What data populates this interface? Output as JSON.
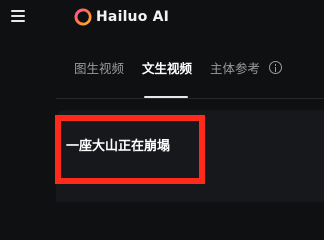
{
  "app": {
    "logo_text": "Hailuo AI",
    "logo_icon": "hailuo-swirl-logo",
    "menu_icon": "hamburger-menu-icon"
  },
  "tabs": [
    {
      "label": "图生视频",
      "active": false
    },
    {
      "label": "文生视频",
      "active": true
    },
    {
      "label": "主体参考",
      "active": false,
      "icon": "info-icon"
    }
  ],
  "prompt": {
    "text": "一座大山正在崩塌"
  },
  "colors": {
    "background": "#0f1012",
    "highlight": "#ff2a1a",
    "active_tab": "#ffffff",
    "inactive_tab": "#9a9a9a"
  }
}
